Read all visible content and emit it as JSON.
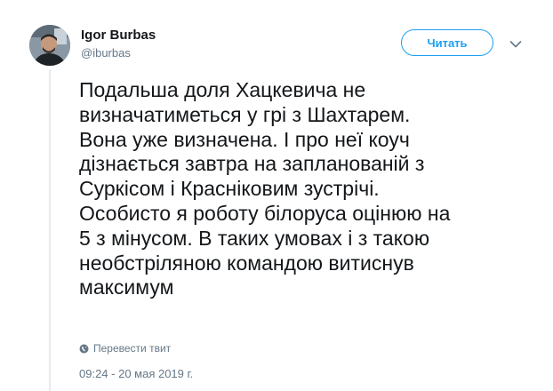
{
  "author": {
    "name": "Igor Burbas",
    "handle": "@iburbas"
  },
  "follow_button": {
    "label": "Читать"
  },
  "menu": {
    "icon": "chevron-down-icon"
  },
  "tweet": {
    "text": "Подальша доля Хацкевича не\nвизначатиметься у грі з Шахтарем.\nВона уже визначена. І про неї коуч\nдізнається завтра на запланованій з\nСуркісом і Красніковим зустрічі.\nОсобисто я роботу білоруса оцінюю на\n5 з мінусом. В таких умовах і з такою\nнеобстріляною командою витиснув\nмаксимум",
    "translate_label": "Перевести твит",
    "timestamp": "09:24 - 20 мая 2019 г."
  },
  "colors": {
    "accent": "#1da1f2",
    "secondary_text": "#657786",
    "primary_text": "#14171a",
    "thread_line": "#e6ecf0"
  }
}
